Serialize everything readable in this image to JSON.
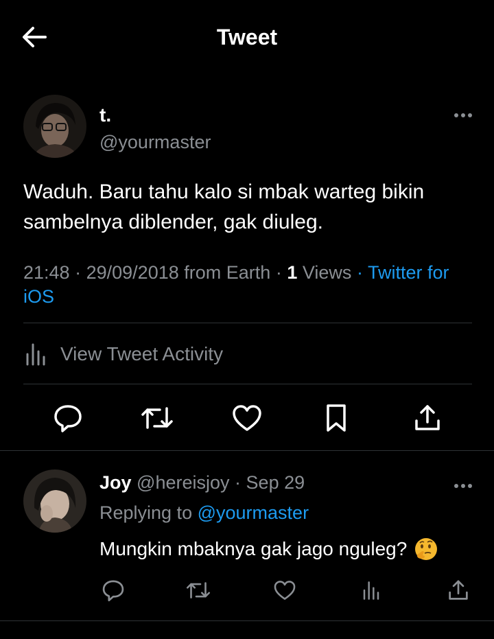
{
  "header": {
    "title": "Tweet",
    "back_icon": "arrow-left-icon"
  },
  "tweet": {
    "author_name": "t.",
    "author_handle": "@yourmaster",
    "text": "Waduh. Baru tahu kalo si mbak warteg bikin sambelnya diblender, gak diuleg.",
    "time": "21:48",
    "date": "29/09/2018",
    "location": "from Earth",
    "views_count": "1",
    "views_label": "Views",
    "source": "Twitter for iOS",
    "separator": "·"
  },
  "activity": {
    "label": "View Tweet Activity",
    "icon": "bar-chart-icon"
  },
  "actions": [
    "reply-icon",
    "retweet-icon",
    "like-icon",
    "bookmark-icon",
    "share-icon"
  ],
  "reply": {
    "name": "Joy",
    "handle": "@hereisjoy",
    "date": "Sep 29",
    "replying_prefix": "Replying to",
    "replying_to": "@yourmaster",
    "text": "Mungkin mbaknya gak jago nguleg?",
    "emoji": "thinking-face-emoji"
  },
  "colors": {
    "background": "#000000",
    "text": "#ffffff",
    "muted": "#8b8f94",
    "accent": "#1d9bf0",
    "divider": "#2f3336"
  }
}
